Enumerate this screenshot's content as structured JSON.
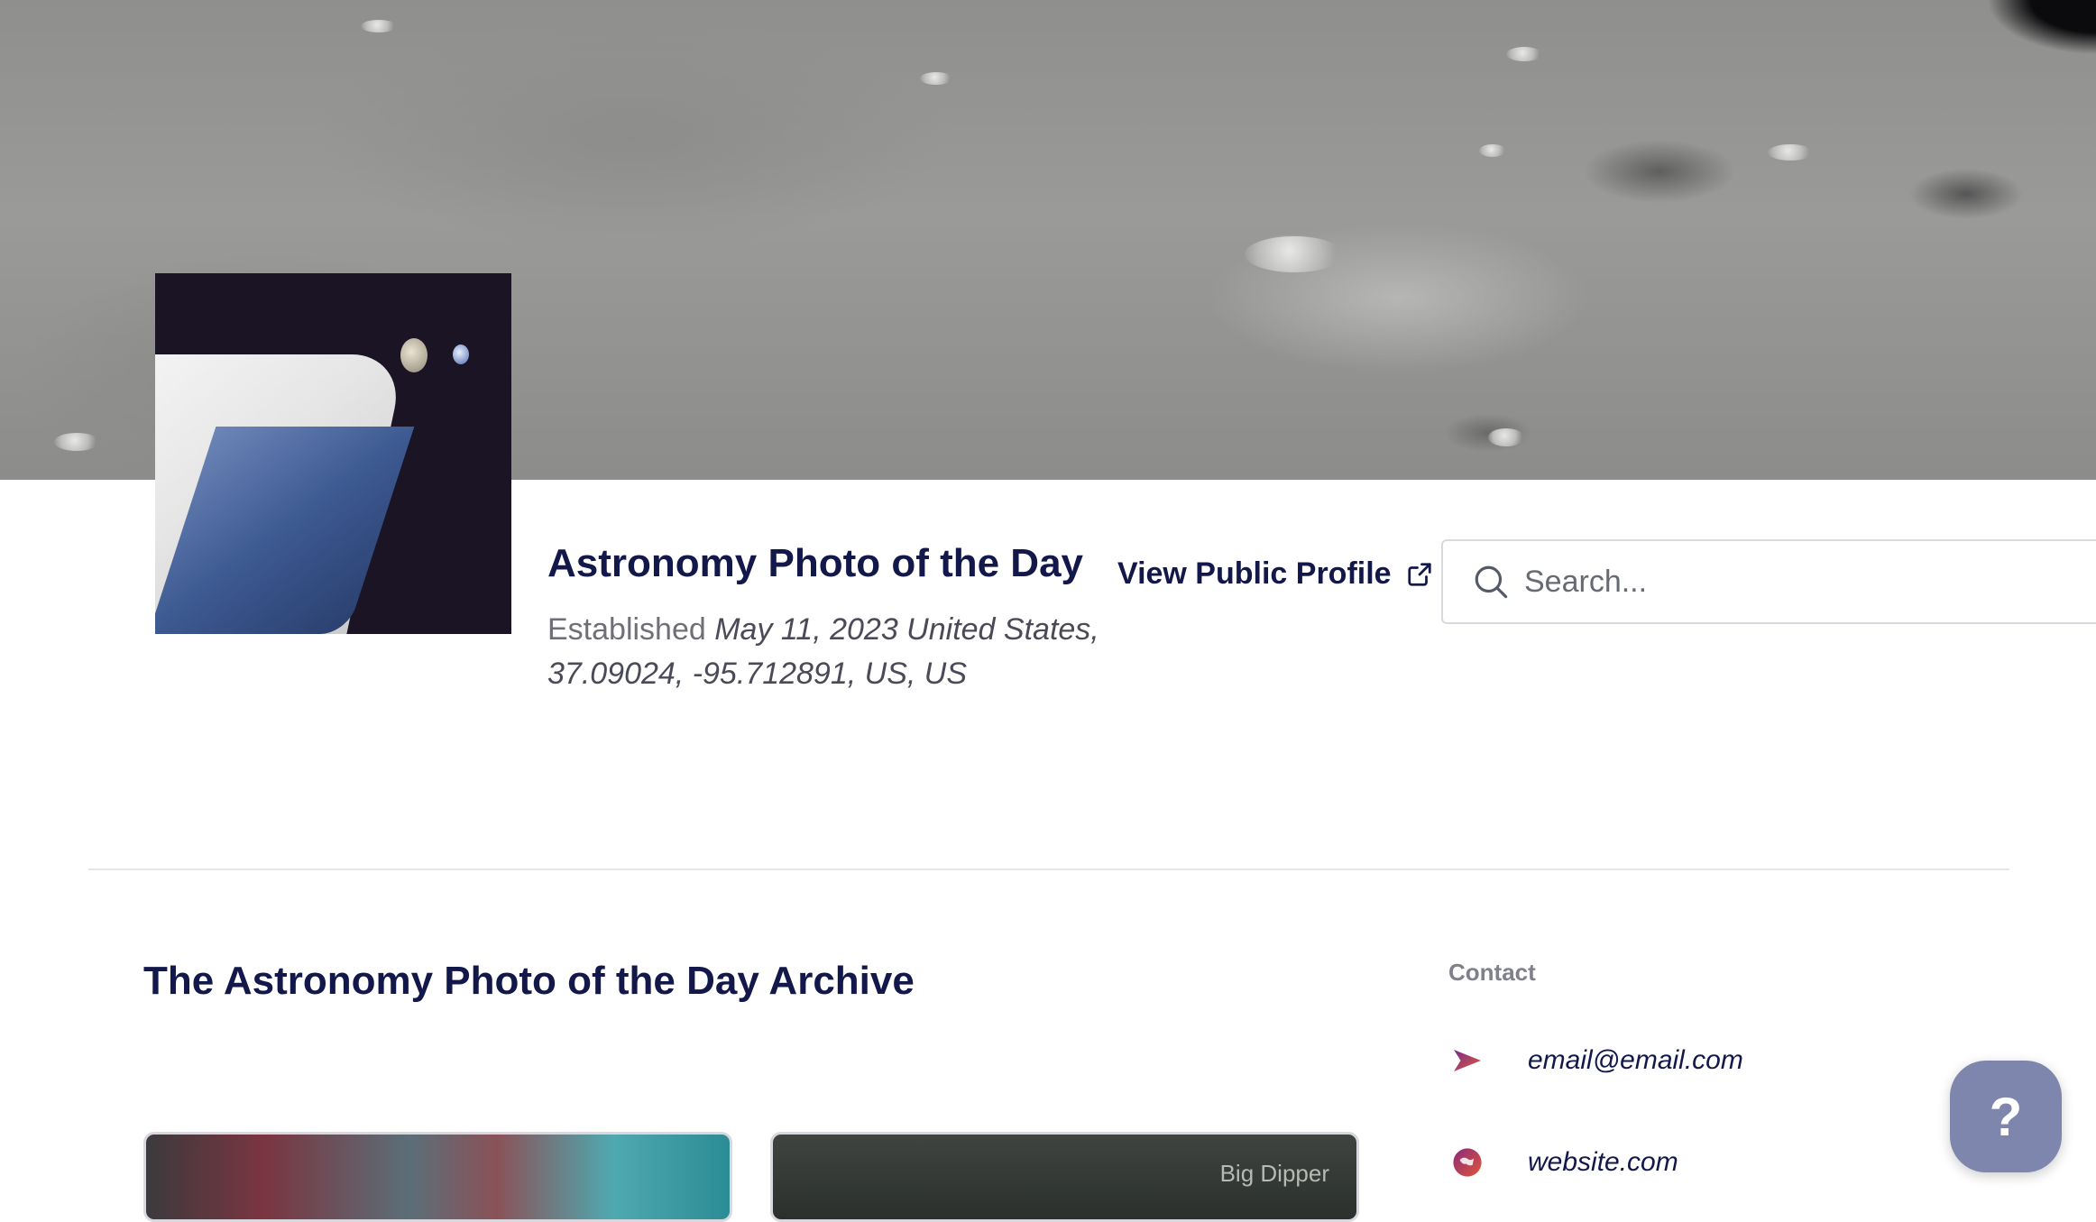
{
  "header": {
    "org_name": "Astronomy Photo of the Day",
    "established_label": "Established",
    "established_value": "May 11, 2023 United States, 37.09024, -95.712891, US, US",
    "view_profile_label": "View Public Profile"
  },
  "search": {
    "placeholder": "Search..."
  },
  "archive": {
    "title": "The Astronomy Photo of the Day Archive",
    "cards": [
      {
        "label": ""
      },
      {
        "label": "Big Dipper"
      }
    ]
  },
  "contact": {
    "label": "Contact",
    "email": "email@email.com",
    "website": "website.com"
  },
  "help": {
    "label": "?"
  },
  "icons": {
    "external_link": "external-link-icon",
    "search": "search-icon",
    "send": "send-icon",
    "globe": "globe-icon"
  },
  "colors": {
    "primary_text": "#13184a",
    "muted_text": "#80808c",
    "help_button": "#7e86ad",
    "divider": "#e4e4ea"
  }
}
